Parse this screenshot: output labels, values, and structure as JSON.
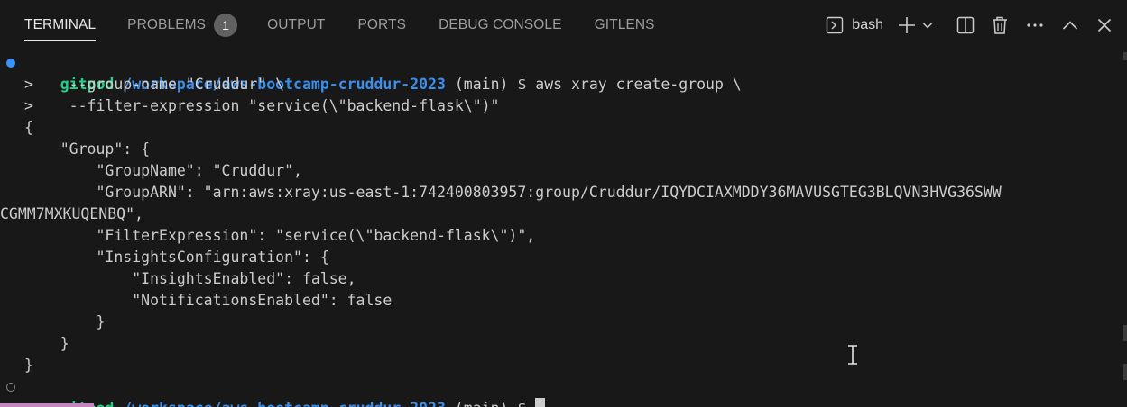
{
  "panel": {
    "tabs": [
      {
        "label": "TERMINAL",
        "active": true
      },
      {
        "label": "PROBLEMS",
        "badge": "1"
      },
      {
        "label": "OUTPUT"
      },
      {
        "label": "PORTS"
      },
      {
        "label": "DEBUG CONSOLE"
      },
      {
        "label": "GITLENS"
      }
    ],
    "terminal_name": "bash",
    "icons": [
      "terminal-icon",
      "plus-icon",
      "chevron-down-icon",
      "split-editor-icon",
      "trash-icon",
      "more-icon",
      "chevron-up-icon",
      "close-icon"
    ]
  },
  "terminal": {
    "prompt_user": "gitpod",
    "prompt_path": "/workspace/aws-bootcamp-cruddur-2023",
    "prompt_branch": " (main) $ ",
    "command": "aws xray create-group \\",
    "continuation_lines": [
      ">    --group-name \"Cruddur\" \\",
      ">    --filter-expression \"service(\\\"backend-flask\\\")\""
    ],
    "output_lines": [
      "{",
      "    \"Group\": {",
      "        \"GroupName\": \"Cruddur\",",
      "        \"GroupARN\": \"arn:aws:xray:us-east-1:742400803957:group/Cruddur/IQYDCIAXMDDY36MAVUSGTEG3BLQVN3HVG36SWW",
      "CGMM7MXKUQENBQ\",",
      "        \"FilterExpression\": \"service(\\\"backend-flask\\\")\",",
      "        \"InsightsConfiguration\": {",
      "            \"InsightsEnabled\": false,",
      "            \"NotificationsEnabled\": false",
      "        }",
      "    }",
      "}"
    ]
  },
  "colors": {
    "background": "#181818",
    "prompt_user": "#23d18b",
    "prompt_path": "#3b8eea",
    "success_dot": "#3794ff"
  }
}
